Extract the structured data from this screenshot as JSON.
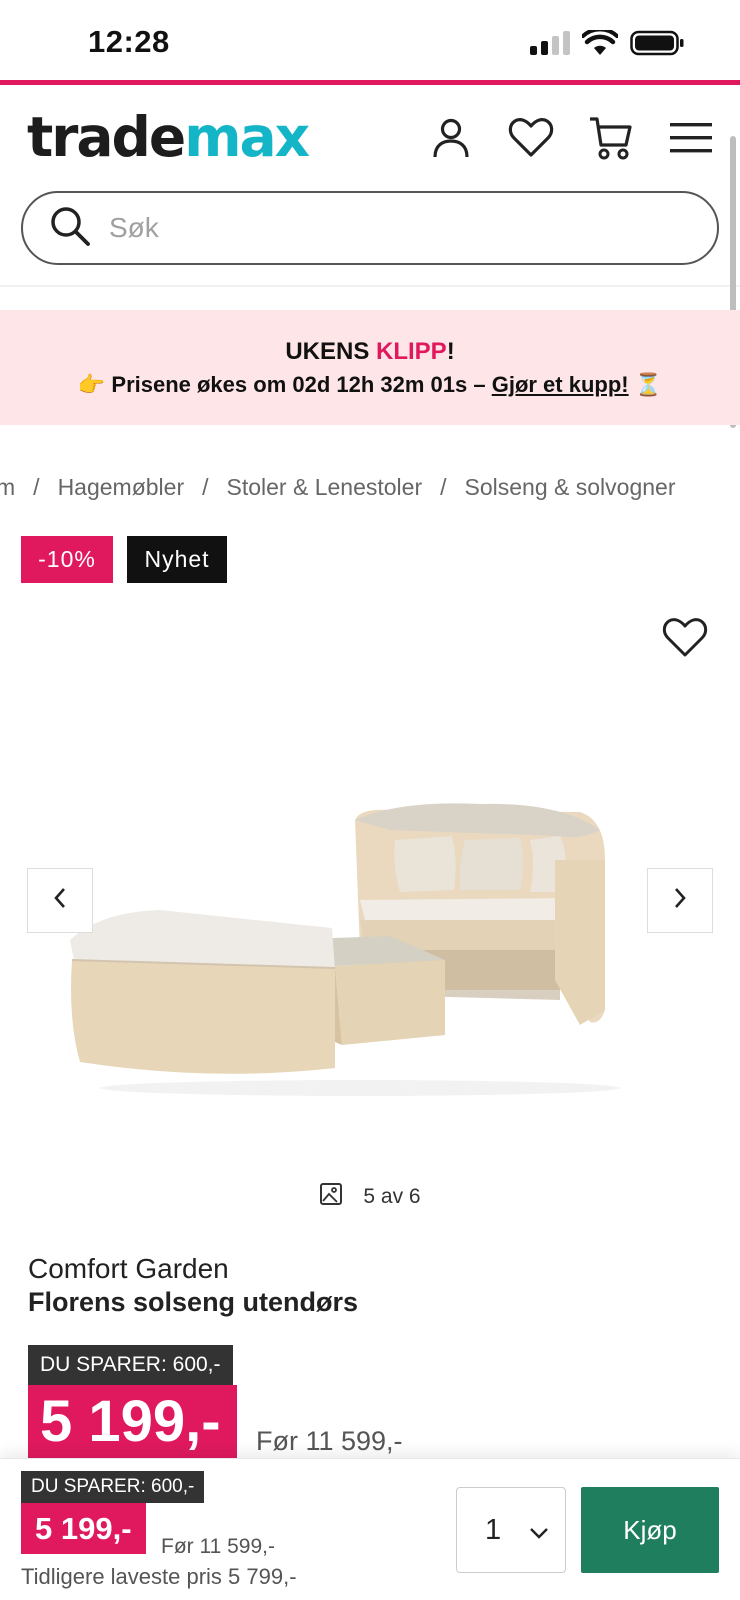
{
  "status_bar": {
    "time": "12:28"
  },
  "brand_logo": {
    "part1": "trade",
    "part2": "max",
    "colors": {
      "part1": "#1d1d1d",
      "part2": "#15b5c8"
    }
  },
  "header_icons": [
    "user-icon",
    "heart-icon",
    "cart-icon",
    "menu-icon"
  ],
  "search": {
    "placeholder": "Søk"
  },
  "promo": {
    "title_prefix": "UKENS ",
    "title_highlight": "KLIPP",
    "title_suffix": "!",
    "emoji_left": "👉",
    "text": "Prisene økes om 02d 12h 32m 01s – ",
    "link": "Gjør et kupp!",
    "emoji_right": "⏳"
  },
  "breadcrumb": {
    "items": [
      "m",
      "Hagemøbler",
      "Stoler & Lenestoler",
      "Solseng & solvogner"
    ],
    "separator": "/"
  },
  "badges": {
    "discount": "-10%",
    "new": "Nyhet"
  },
  "gallery": {
    "counter": "5 av 6"
  },
  "product": {
    "brand": "Comfort Garden",
    "name": "Florens solseng utendørs",
    "save_label": "DU SPARER: 600,-",
    "price": "5 199,-",
    "old_price": "Før 11 599,-"
  },
  "sticky_bar": {
    "save_label": "DU SPARER: 600,-",
    "price": "5 199,-",
    "old_price": "Før 11 599,-",
    "lowest_price": "Tidligere laveste pris 5 799,-",
    "quantity": "1",
    "buy_label": "Kjøp"
  },
  "colors": {
    "accent": "#e0195f",
    "buy": "#1f7e5e",
    "promo_bg": "#fde5e8"
  }
}
